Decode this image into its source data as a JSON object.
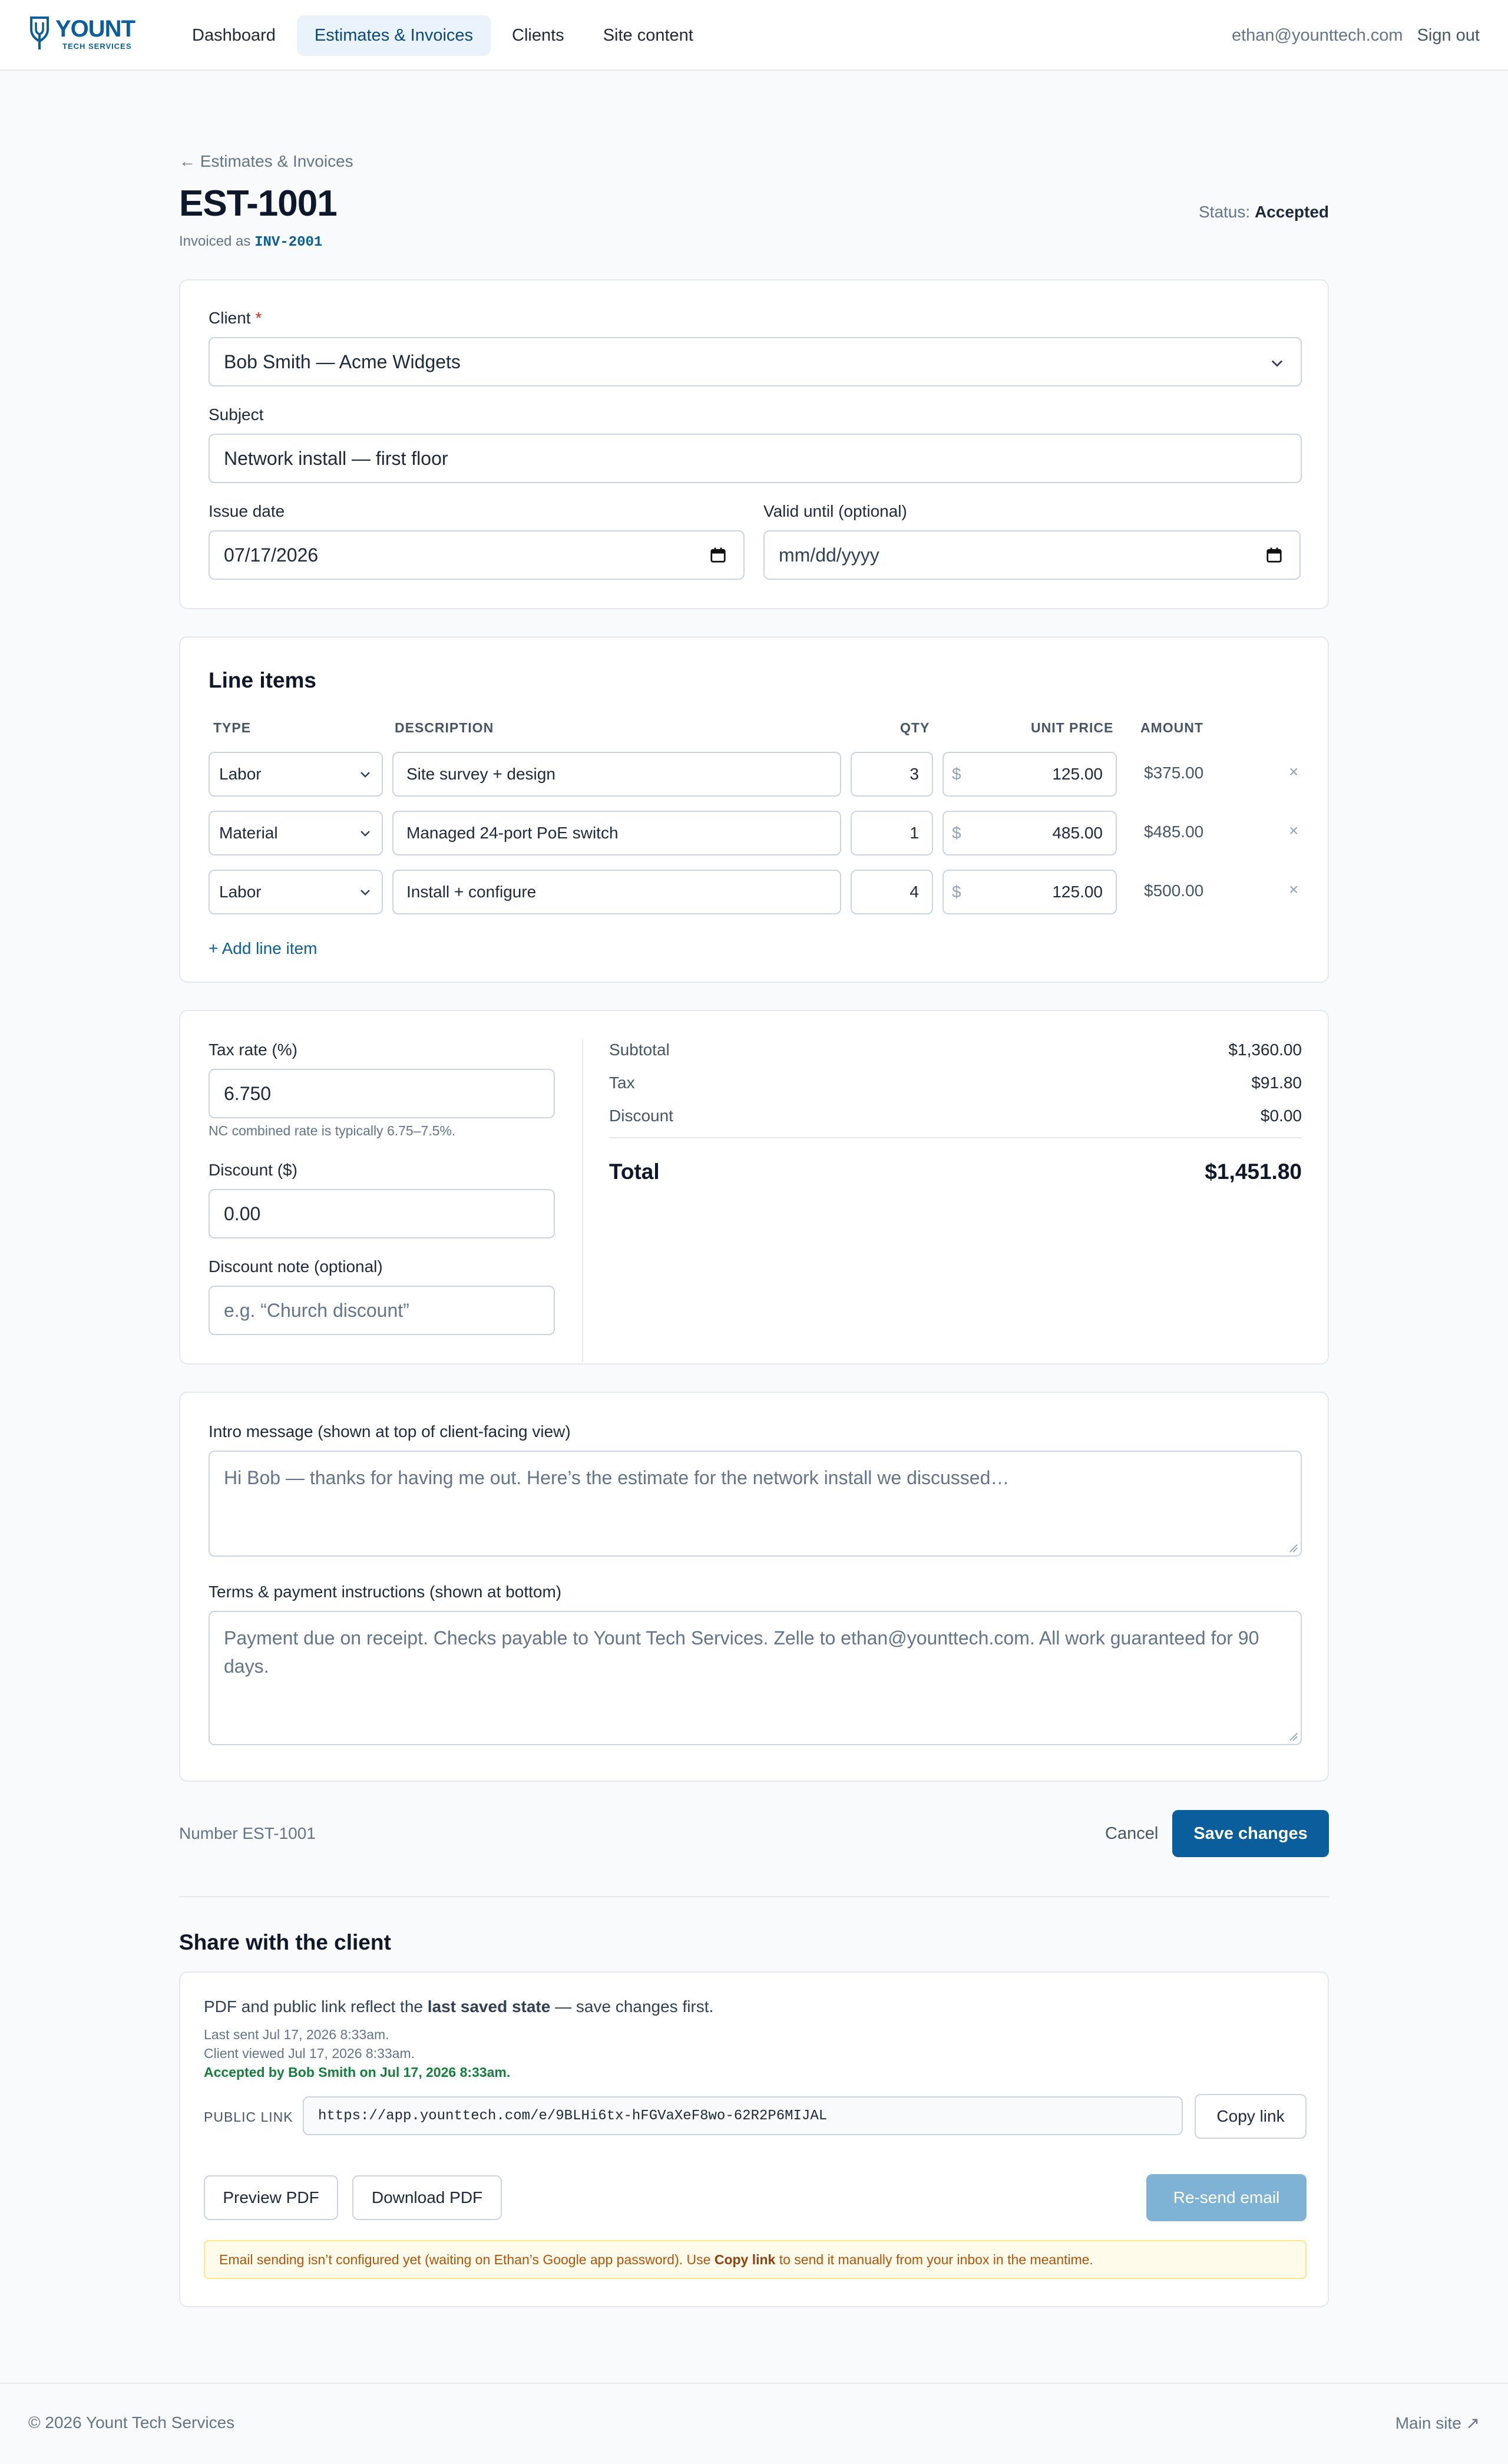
{
  "brand": {
    "name": "YOUNT",
    "sub": "TECH SERVICES",
    "color": "#0b5e9c"
  },
  "nav": {
    "links": [
      "Dashboard",
      "Estimates & Invoices",
      "Clients",
      "Site content"
    ],
    "active": "Estimates & Invoices",
    "email": "ethan@younttech.com",
    "signout": "Sign out"
  },
  "header": {
    "breadcrumb": "← Estimates & Invoices",
    "title": "EST-1001",
    "invoiced_prefix": "Invoiced as",
    "invoice_number": "INV-2001",
    "status_label": "Status:",
    "status_value": "Accepted"
  },
  "details": {
    "client_label": "Client",
    "client_required": "*",
    "client_value": "Bob Smith — Acme Widgets",
    "subject_label": "Subject",
    "subject_value": "Network install — first floor",
    "issue_label": "Issue date",
    "issue_value": "07/17/2026",
    "valid_label": "Valid until (optional)",
    "valid_placeholder": "mm/dd/yyyy"
  },
  "line_items": {
    "title": "Line items",
    "columns": [
      "TYPE",
      "DESCRIPTION",
      "QTY",
      "UNIT PRICE",
      "AMOUNT"
    ],
    "currency_symbol": "$",
    "remove_glyph": "×",
    "rows": [
      {
        "type": "Labor",
        "description": "Site survey + design",
        "qty": "3",
        "unit_price": "125.00",
        "amount": "$375.00"
      },
      {
        "type": "Material",
        "description": "Managed 24-port PoE switch",
        "qty": "1",
        "unit_price": "485.00",
        "amount": "$485.00"
      },
      {
        "type": "Labor",
        "description": "Install + configure",
        "qty": "4",
        "unit_price": "125.00",
        "amount": "$500.00"
      }
    ],
    "add_label": "+ Add line item"
  },
  "totals": {
    "tax_label": "Tax rate (%)",
    "tax_value": "6.750",
    "tax_help": "NC combined rate is typically 6.75–7.5%.",
    "discount_label": "Discount ($)",
    "discount_value": "0.00",
    "note_label": "Discount note (optional)",
    "note_placeholder": "e.g. “Church discount”",
    "subtotal_label": "Subtotal",
    "subtotal_value": "$1,360.00",
    "tax_row_label": "Tax",
    "tax_row_value": "$91.80",
    "discount_row_label": "Discount",
    "discount_row_value": "$0.00",
    "total_label": "Total",
    "total_value": "$1,451.80"
  },
  "messages": {
    "intro_label": "Intro message (shown at top of client-facing view)",
    "intro_placeholder": "Hi Bob — thanks for having me out. Here’s the estimate for the network install we discussed…",
    "terms_label": "Terms & payment instructions (shown at bottom)",
    "terms_placeholder": "Payment due on receipt. Checks payable to Yount Tech Services. Zelle to ethan@younttech.com. All work guaranteed for 90 days."
  },
  "actions": {
    "number_label": "Number EST-1001",
    "cancel": "Cancel",
    "save": "Save changes"
  },
  "share": {
    "title": "Share with the client",
    "note_pre": "PDF and public link reflect the",
    "note_bold": "last saved state",
    "note_post": "— save changes first.",
    "last_sent": "Last sent Jul 17, 2026 8:33am.",
    "viewed": "Client viewed Jul 17, 2026 8:33am.",
    "accepted": "Accepted by Bob Smith on Jul 17, 2026 8:33am.",
    "public_link_label": "PUBLIC LINK",
    "public_link": "https://app.younttech.com/e/9BLHi6tx-hFGVaXeF8wo-62R2P6MIJAL",
    "copy_link": "Copy link",
    "preview_pdf": "Preview PDF",
    "download_pdf": "Download PDF",
    "resend": "Re-send email",
    "warn_pre": "Email sending isn’t configured yet (waiting on Ethan’s Google app password). Use",
    "warn_bold": "Copy link",
    "warn_post": "to send it manually from your inbox in the meantime."
  },
  "footer": {
    "copyright": "© 2026 Yount Tech Services",
    "main_site": "Main site ↗"
  }
}
